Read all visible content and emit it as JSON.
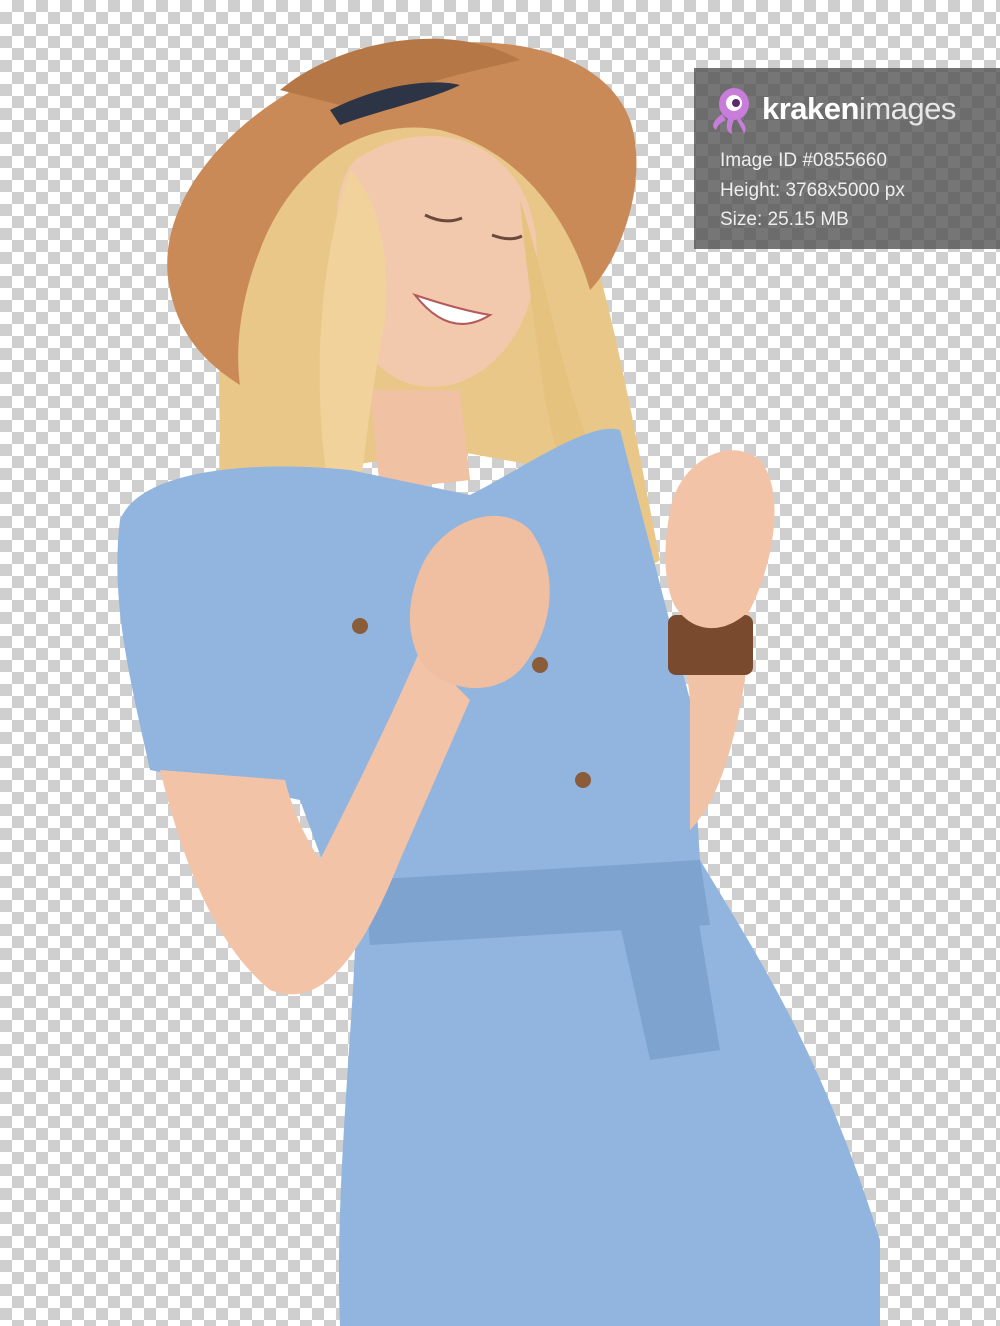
{
  "watermark": {
    "brand_bold": "kraken",
    "brand_light": "images",
    "image_id": "Image ID #0855660",
    "height": "Height: 3768x5000 px",
    "size": "Size: 25.15 MB",
    "logo_icon": "octopus-icon",
    "logo_color": "#c77dd9"
  },
  "photo": {
    "subject": "woman",
    "hat_color": "#c98a57",
    "hair_color": "#ecc98a",
    "skin_color": "#f1c3a6",
    "outfit_color": "#8fb3dc",
    "watch_color": "#7a4a2e"
  }
}
